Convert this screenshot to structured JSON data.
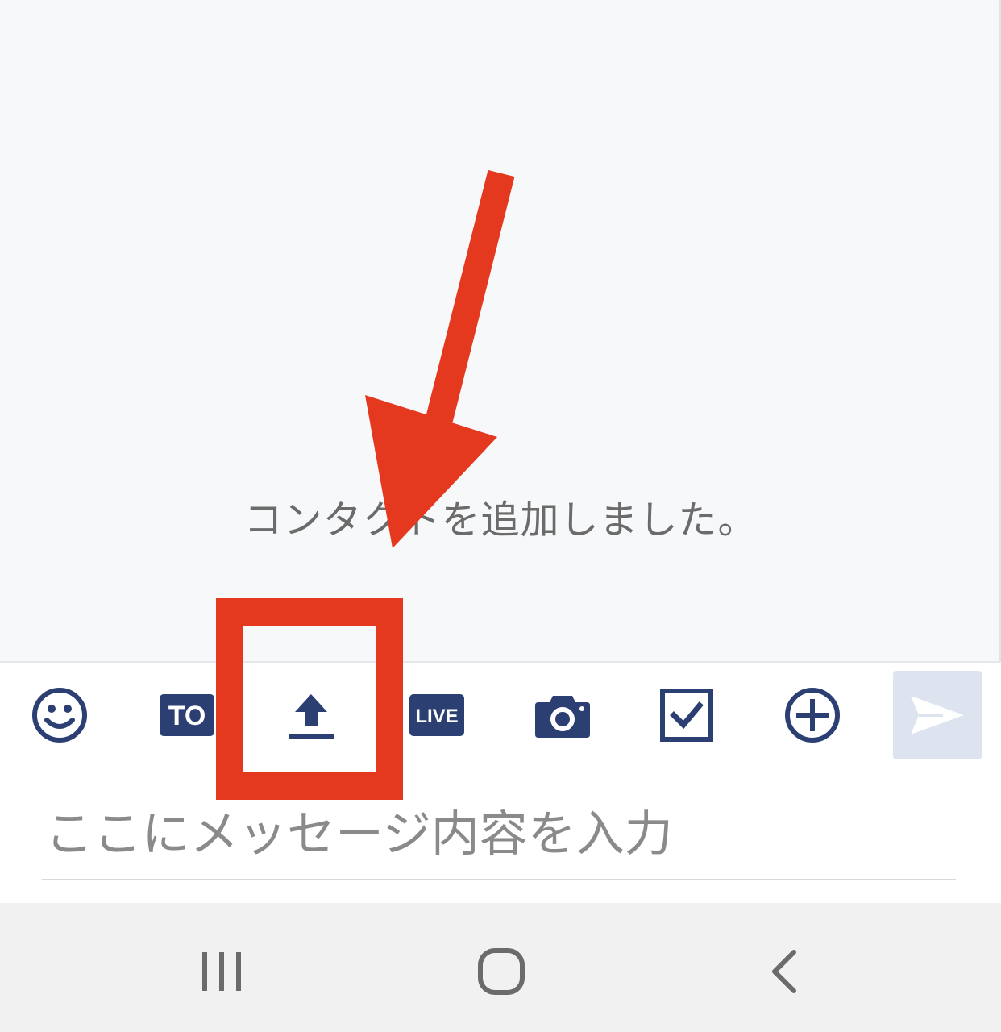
{
  "chat": {
    "system_message": "コンタクトを追加しました。"
  },
  "toolbar": {
    "items": [
      {
        "name": "emoji",
        "icon": "smiley-icon"
      },
      {
        "name": "to",
        "icon": "to-badge-icon",
        "label": "TO"
      },
      {
        "name": "upload",
        "icon": "upload-icon"
      },
      {
        "name": "live",
        "icon": "live-badge-icon",
        "label": "LIVE"
      },
      {
        "name": "camera",
        "icon": "camera-icon"
      },
      {
        "name": "task",
        "icon": "checkbox-icon"
      },
      {
        "name": "more",
        "icon": "plus-circle-icon"
      }
    ],
    "send_icon": "send-icon"
  },
  "input": {
    "placeholder": "ここにメッセージ内容を入力"
  },
  "navbar": {
    "recents_icon": "recents-icon",
    "home_icon": "home-icon",
    "back_icon": "back-icon"
  },
  "annotation": {
    "highlight_target": "upload",
    "arrow_icon": "arrow-annotation",
    "color": "#e5391f"
  },
  "colors": {
    "icon": "#2b3f73",
    "send_bg": "#dde3ef",
    "chat_bg": "#f7f8fa"
  }
}
